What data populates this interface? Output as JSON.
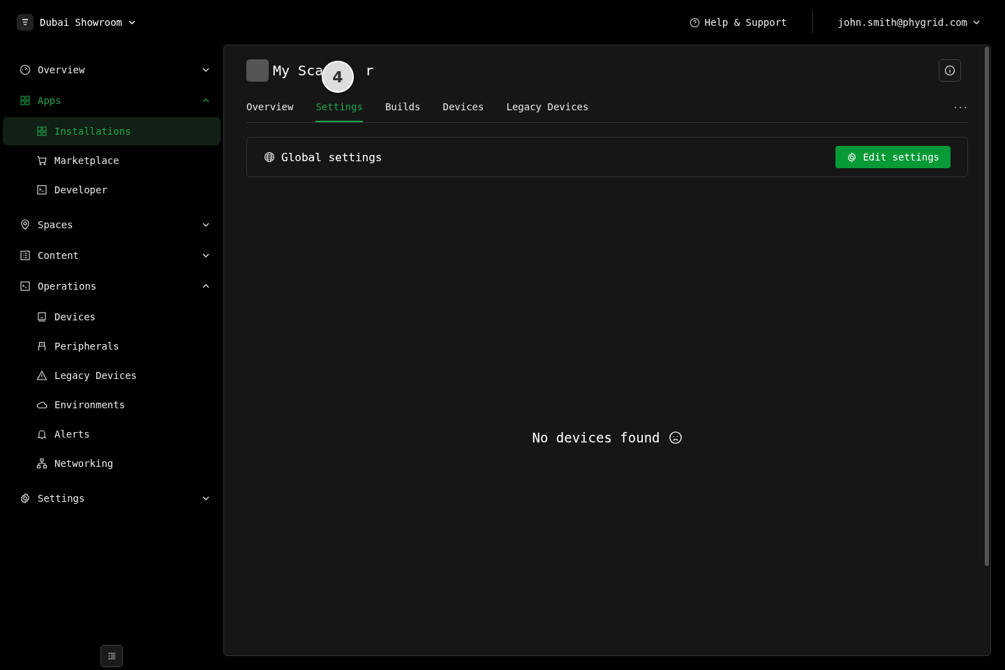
{
  "workspace": {
    "name": "Dubai Showroom"
  },
  "topbar": {
    "help": "Help & Support",
    "user": "john.smith@phygrid.com"
  },
  "sidebar": {
    "items": [
      {
        "label": "Overview",
        "expanded": false,
        "selected": false
      },
      {
        "label": "Apps",
        "expanded": true,
        "selected": true,
        "children": [
          {
            "label": "Installations",
            "selected": true
          },
          {
            "label": "Marketplace",
            "selected": false
          },
          {
            "label": "Developer",
            "selected": false
          }
        ]
      },
      {
        "label": "Spaces",
        "expanded": false,
        "selected": false
      },
      {
        "label": "Content",
        "expanded": false,
        "selected": false
      },
      {
        "label": "Operations",
        "expanded": true,
        "selected": false,
        "children": [
          {
            "label": "Devices",
            "selected": false
          },
          {
            "label": "Peripherals",
            "selected": false
          },
          {
            "label": "Legacy Devices",
            "selected": false
          },
          {
            "label": "Environments",
            "selected": false
          },
          {
            "label": "Alerts",
            "selected": false
          },
          {
            "label": "Networking",
            "selected": false
          }
        ]
      },
      {
        "label": "Settings",
        "expanded": false,
        "selected": false
      }
    ]
  },
  "app": {
    "title_parts": [
      "My Sca",
      "r"
    ],
    "step_badge": "4"
  },
  "tabs": [
    {
      "label": "Overview",
      "selected": false
    },
    {
      "label": "Settings",
      "selected": true
    },
    {
      "label": "Builds",
      "selected": false
    },
    {
      "label": "Devices",
      "selected": false
    },
    {
      "label": "Legacy Devices",
      "selected": false
    }
  ],
  "more": "···",
  "settings_card": {
    "title": "Global settings",
    "button": "Edit settings"
  },
  "empty_state": "No devices found"
}
